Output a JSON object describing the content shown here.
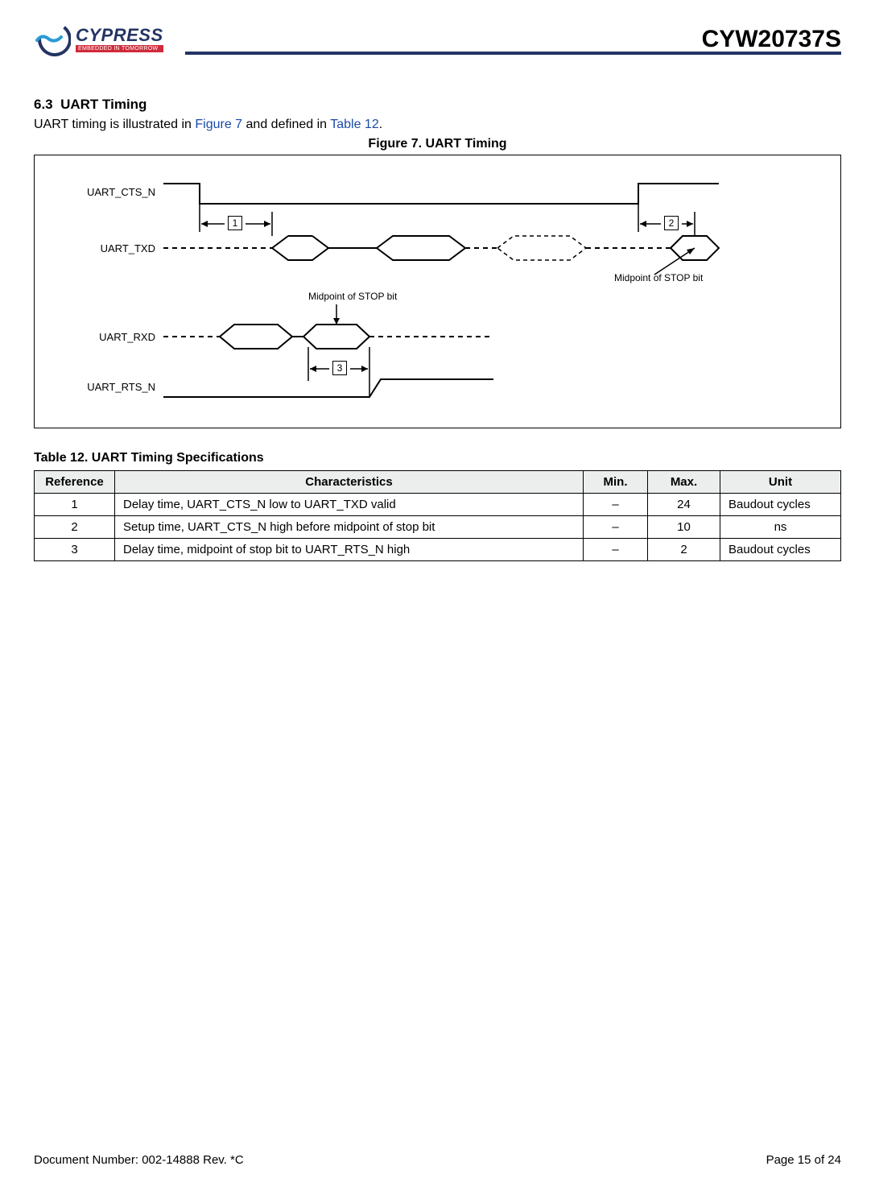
{
  "header": {
    "logo_main": "CYPRESS",
    "logo_sub": "EMBEDDED IN TOMORROW",
    "part_number": "CYW20737S"
  },
  "section": {
    "number": "6.3",
    "title": "UART Timing",
    "intro_pre": "UART timing is illustrated in ",
    "intro_link1": "Figure 7",
    "intro_mid": " and defined in ",
    "intro_link2": "Table 12",
    "intro_end": "."
  },
  "figure": {
    "caption": "Figure 7. UART Timing",
    "signals": {
      "cts": "UART_CTS_N",
      "txd": "UART_TXD",
      "rxd": "UART_RXD",
      "rts": "UART_RTS_N"
    },
    "annotations": {
      "midpoint_top": "Midpoint of STOP bit",
      "midpoint_mid": "Midpoint of STOP bit"
    },
    "dims": {
      "d1": "1",
      "d2": "2",
      "d3": "3"
    }
  },
  "table": {
    "caption": "Table 12. UART Timing Specifications",
    "headers": {
      "ref": "Reference",
      "char": "Characteristics",
      "min": "Min.",
      "max": "Max.",
      "unit": "Unit"
    },
    "rows": [
      {
        "ref": "1",
        "char": "Delay time, UART_CTS_N low to UART_TXD valid",
        "min": "–",
        "max": "24",
        "unit": "Baudout cycles"
      },
      {
        "ref": "2",
        "char": "Setup time, UART_CTS_N high before midpoint of stop bit",
        "min": "–",
        "max": "10",
        "unit": "ns"
      },
      {
        "ref": "3",
        "char": "Delay time, midpoint of stop bit to UART_RTS_N high",
        "min": "–",
        "max": "2",
        "unit": "Baudout cycles"
      }
    ]
  },
  "footer": {
    "doc_number": "Document Number: 002-14888 Rev. *C",
    "page": "Page 15 of 24"
  }
}
